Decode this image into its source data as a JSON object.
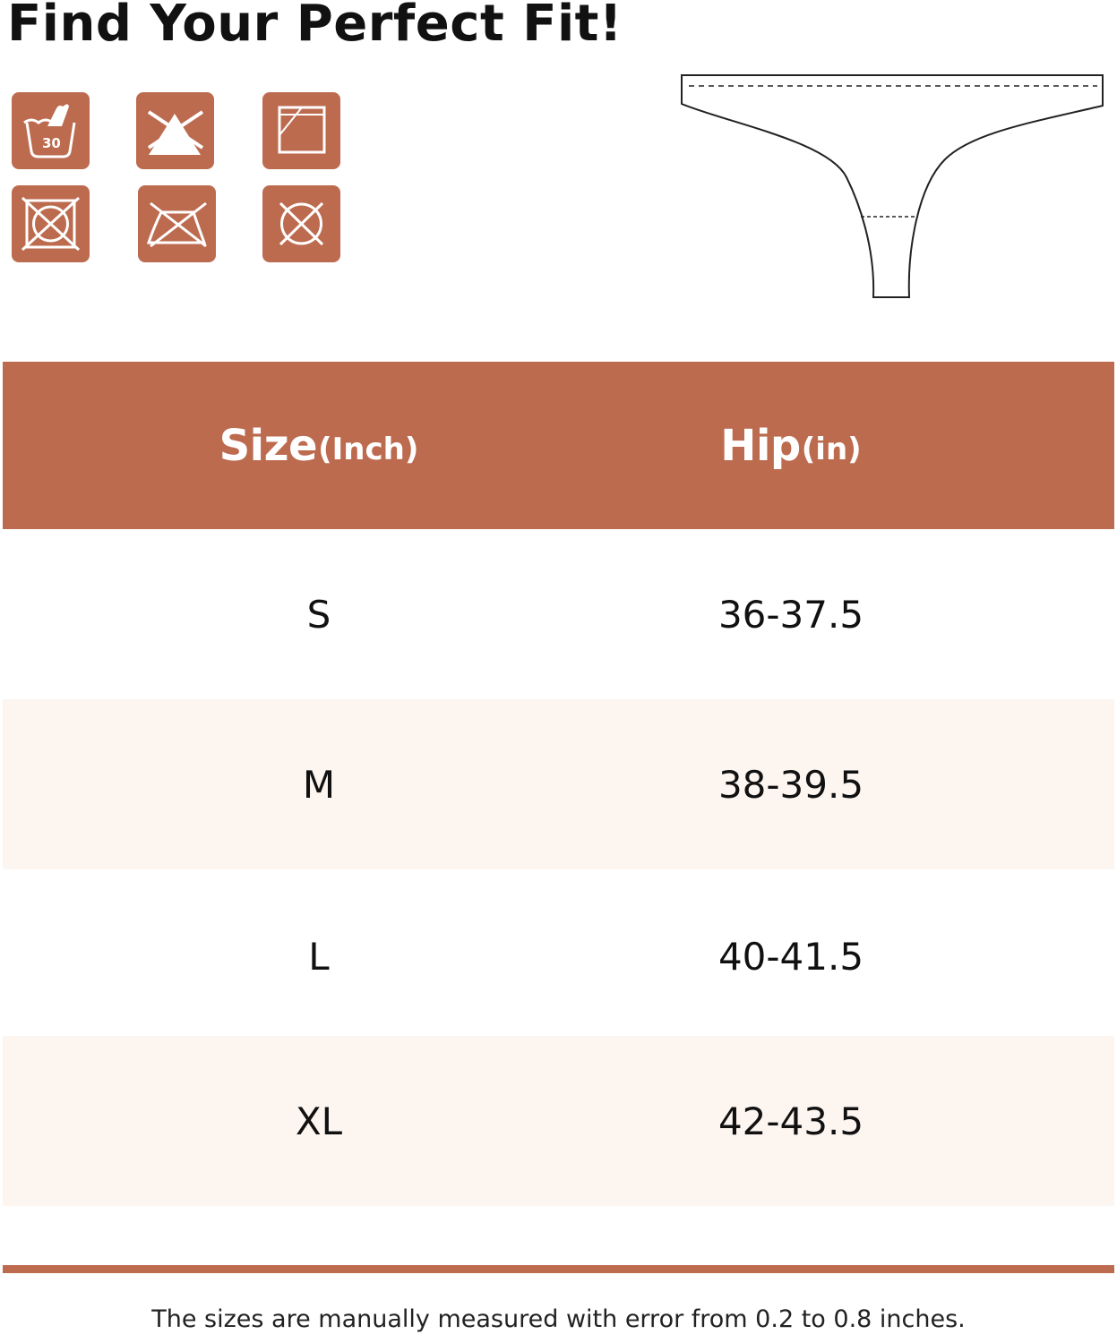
{
  "title": "Find Your Perfect Fit!",
  "colors": {
    "accent": "#bd6b4f",
    "row_alt": "#fdf5f0",
    "text": "#111111"
  },
  "care_icons": [
    {
      "name": "hand-wash-30-icon",
      "label": "30"
    },
    {
      "name": "do-not-bleach-icon"
    },
    {
      "name": "dry-flat-icon"
    },
    {
      "name": "do-not-tumble-dry-icon"
    },
    {
      "name": "do-not-iron-icon"
    },
    {
      "name": "do-not-dry-clean-icon"
    }
  ],
  "garment_illustration": {
    "name": "thong-outline-illustration"
  },
  "table": {
    "headers": [
      {
        "main": "Size",
        "unit": "(Inch)"
      },
      {
        "main": "Hip",
        "unit": "(in)"
      }
    ],
    "rows": [
      {
        "size": "S",
        "hip": "36-37.5"
      },
      {
        "size": "M",
        "hip": "38-39.5"
      },
      {
        "size": "L",
        "hip": "40-41.5"
      },
      {
        "size": "XL",
        "hip": "42-43.5"
      }
    ]
  },
  "note": "The sizes are manually measured with error from 0.2 to 0.8 inches."
}
